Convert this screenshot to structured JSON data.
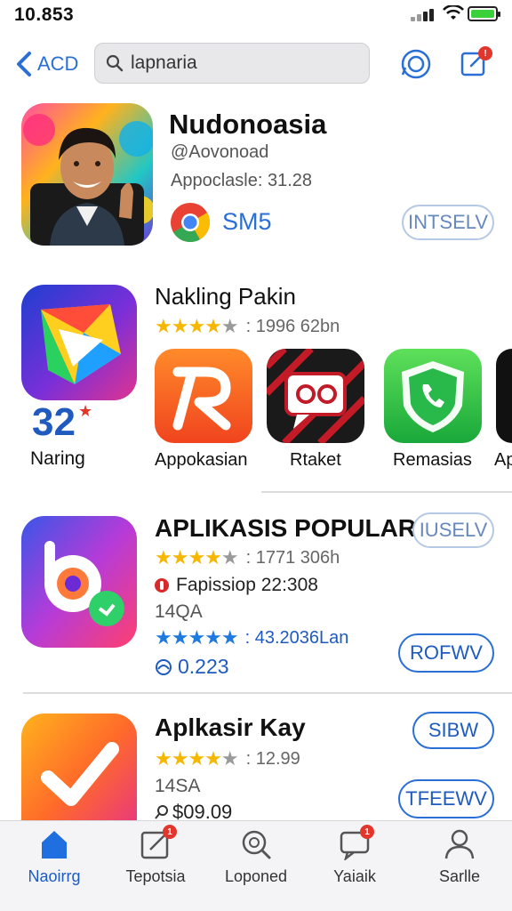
{
  "status": {
    "time": "10.853"
  },
  "nav": {
    "back_label": "ACD",
    "search_value": "lapnaria"
  },
  "featured": {
    "title": "Nudonoasia",
    "developer": "@Aovonoad",
    "meta": "Appoclasle:  31.28",
    "price": "SM5",
    "button": "INTSELV"
  },
  "section2": {
    "title": "Nakling Pakin",
    "rating_text": ": 1996 62bn",
    "rank_number": "32",
    "rank_label": "Naring",
    "apps": [
      {
        "label": "Appokasian",
        "icon": "letter-r-icon"
      },
      {
        "label": "Rtaket",
        "icon": "chat-rings-icon"
      },
      {
        "label": "Remasias",
        "icon": "phone-chat-icon"
      },
      {
        "label": "Ap"
      }
    ]
  },
  "row1": {
    "title": "APLIKASIS POPULAR",
    "button": "IUSELV",
    "rating_text": ": 1771 306h",
    "flag_text": "Fapissiop 22:308",
    "code": "14QA",
    "rating2_text": ": 43.2036Lan",
    "views": "0.223",
    "button2": "ROFWV"
  },
  "row2": {
    "title": "Aplkasir Kay",
    "button": "SIBW",
    "rating_text": ": 12.99",
    "code": "14SA",
    "price": "$09.09",
    "button2": "TFEEWV"
  },
  "tabs": [
    {
      "label": "Naoirrg",
      "icon": "home-icon"
    },
    {
      "label": "Tepotsia",
      "icon": "edit-icon"
    },
    {
      "label": "Loponed",
      "icon": "search-icon"
    },
    {
      "label": "Yaiaik",
      "icon": "chat-icon"
    },
    {
      "label": "Sarlle",
      "icon": "person-icon"
    }
  ],
  "colors": {
    "accent": "#1f5bbf",
    "star": "#f5b700",
    "badge": "#e2352b"
  }
}
